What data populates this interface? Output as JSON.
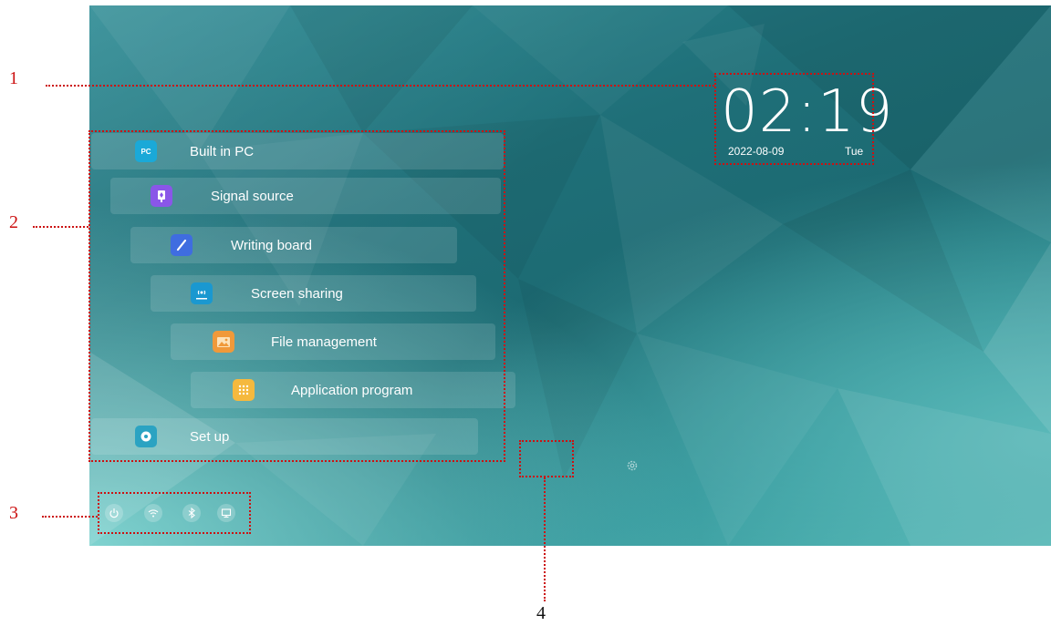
{
  "clock": {
    "time": "02:19",
    "date": "2022-08-09",
    "day": "Tue"
  },
  "menu": {
    "items": [
      {
        "label": "Built in PC",
        "icon": "pc-icon",
        "icon_text": "PC",
        "color": "#1aa9d8"
      },
      {
        "label": "Signal source",
        "icon": "signal-source-icon",
        "color": "#8a56e8"
      },
      {
        "label": "Writing board",
        "icon": "writing-board-icon",
        "color": "#3f6de0"
      },
      {
        "label": "Screen sharing",
        "icon": "screen-sharing-icon",
        "color": "#1a98d0"
      },
      {
        "label": "File management",
        "icon": "file-management-icon",
        "color": "#f0993a"
      },
      {
        "label": "Application program",
        "icon": "application-program-icon",
        "color": "#f5b93e"
      },
      {
        "label": "Set up",
        "icon": "setup-icon",
        "color": "#2ba3c2"
      }
    ]
  },
  "tray": {
    "icons": [
      "power-icon",
      "wifi-icon",
      "bluetooth-icon",
      "display-icon"
    ]
  },
  "settings": {
    "icon": "gear-icon"
  },
  "callouts": {
    "labels": [
      "1",
      "2",
      "3",
      "4"
    ],
    "color": "#cc1111"
  }
}
